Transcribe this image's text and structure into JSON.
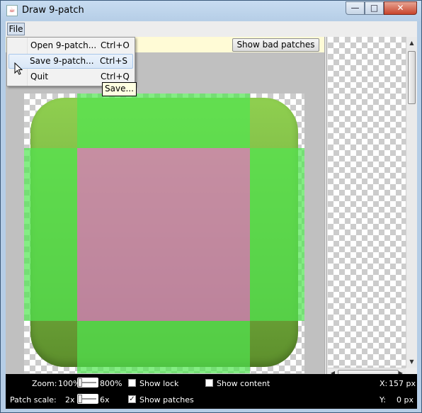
{
  "window": {
    "title": "Draw 9-patch",
    "app_icon": "java-icon",
    "buttons": {
      "minimize": "—",
      "maximize": "□",
      "close": "✕"
    }
  },
  "menubar": {
    "file": "File"
  },
  "file_menu": {
    "items": [
      {
        "label": "Open 9-patch...",
        "accel": "Ctrl+O"
      },
      {
        "label": "Save 9-patch...",
        "accel": "Ctrl+S"
      },
      {
        "label": "Quit",
        "accel": "Ctrl+Q"
      }
    ],
    "hovered_index": 1
  },
  "tooltip": "Save...",
  "toolbar": {
    "show_bad_patches": "Show bad patches"
  },
  "status": {
    "zoom_label": "Zoom:",
    "zoom_min": "100%",
    "zoom_max": "800%",
    "zoom_value": 0,
    "patch_scale_label": "Patch scale:",
    "patch_min": "2x",
    "patch_max": "6x",
    "patch_value": 0,
    "show_lock": "Show lock",
    "show_content": "Show content",
    "show_patches": "Show patches",
    "show_lock_checked": false,
    "show_content_checked": false,
    "show_patches_checked": true,
    "x_label": "X:",
    "x_value": "157 px",
    "y_label": "Y:",
    "y_value": "0 px"
  },
  "colors": {
    "patch_green": "#50e650",
    "patch_center": "#e178c8",
    "icon_green": "#7bbd45"
  }
}
